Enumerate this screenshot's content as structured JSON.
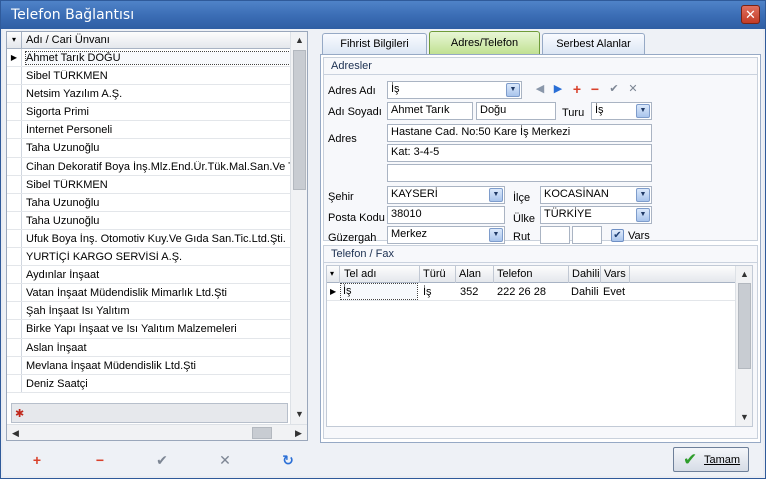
{
  "window": {
    "title": "Telefon Bağlantısı",
    "close_glyph": "✕"
  },
  "left_grid": {
    "header": "Adı / Cari Ünvanı",
    "selected_indicator": "▶",
    "rows": [
      "Ahmet Tarık DOĞU",
      "Sibel TÜRKMEN",
      "Netsim Yazılım A.Ş.",
      "Sigorta Primi",
      "İnternet Personeli",
      "Taha Uzunoğlu",
      "Cihan Dekoratif Boya İnş.Mlz.End.Ür.Tük.Mal.San.Ve Tic",
      "Sibel TÜRKMEN",
      "Taha Uzunoğlu",
      "Taha Uzunoğlu",
      "Ufuk Boya İnş. Otomotiv Kuy.Ve Gıda San.Tic.Ltd.Şti.",
      "YURTİÇİ KARGO SERVİSİ A.Ş.",
      "Aydınlar İnşaat",
      "Vatan İnşaat Müdendislik Mimarlık Ltd.Şti",
      "Şah İnşaat Isı Yalıtım",
      "Birke Yapı İnşaat ve Isı Yalıtım Malzemeleri",
      "Aslan İnşaat",
      "Mevlana  İnşaat Müdendislik Ltd.Şti",
      "Deniz Saatçi"
    ],
    "new_row_glyph": "✱"
  },
  "bottom_toolbar": {
    "add": "+",
    "delete": "−",
    "confirm": "✔",
    "cancel": "✕",
    "refresh": "↻",
    "ok_label": "Tamam",
    "ok_glyph": "✔"
  },
  "tabs": [
    "Fihrist Bilgileri",
    "Adres/Telefon",
    "Serbest Alanlar"
  ],
  "active_tab": "Adres/Telefon",
  "addresses": {
    "caption": "Adresler",
    "adres_adi_label": "Adres Adı",
    "adres_adi_value": "İş",
    "adi_soyadi_label": "Adı Soyadı",
    "first_name": "Ahmet Tarık",
    "last_name": "Doğu",
    "turu_label": "Turu",
    "turu_value": "İş",
    "adres_label": "Adres",
    "adres_line1": "Hastane Cad. No:50 Kare İş Merkezi",
    "adres_line2": "Kat: 3-4-5",
    "adres_line3": "",
    "sehir_label": "Şehir",
    "sehir_value": "KAYSERİ",
    "ilce_label": "İlçe",
    "ilce_value": "KOCASİNAN",
    "posta_kodu_label": "Posta Kodu",
    "posta_kodu_value": "38010",
    "ulke_label": "Ülke",
    "ulke_value": "TÜRKİYE",
    "guzergah_label": "Güzergah",
    "guzergah_value": "Merkez",
    "rut_label": "Rut",
    "vars_label": "Vars"
  },
  "phones": {
    "caption": "Telefon / Fax",
    "columns": [
      "Tel adı",
      "Türü",
      "Alan",
      "Telefon",
      "Dahili",
      "Vars"
    ],
    "row": {
      "tel_adi": "İş",
      "turu": "İş",
      "alan": "352",
      "telefon": "222 26 28",
      "dahili": "Dahili",
      "vars": "Evet"
    }
  },
  "colors": {
    "title_bar": "#3a6cb4",
    "active_tab": "#bfe08f",
    "add": "#d9412b",
    "confirm_green": "#2f9d2c"
  }
}
